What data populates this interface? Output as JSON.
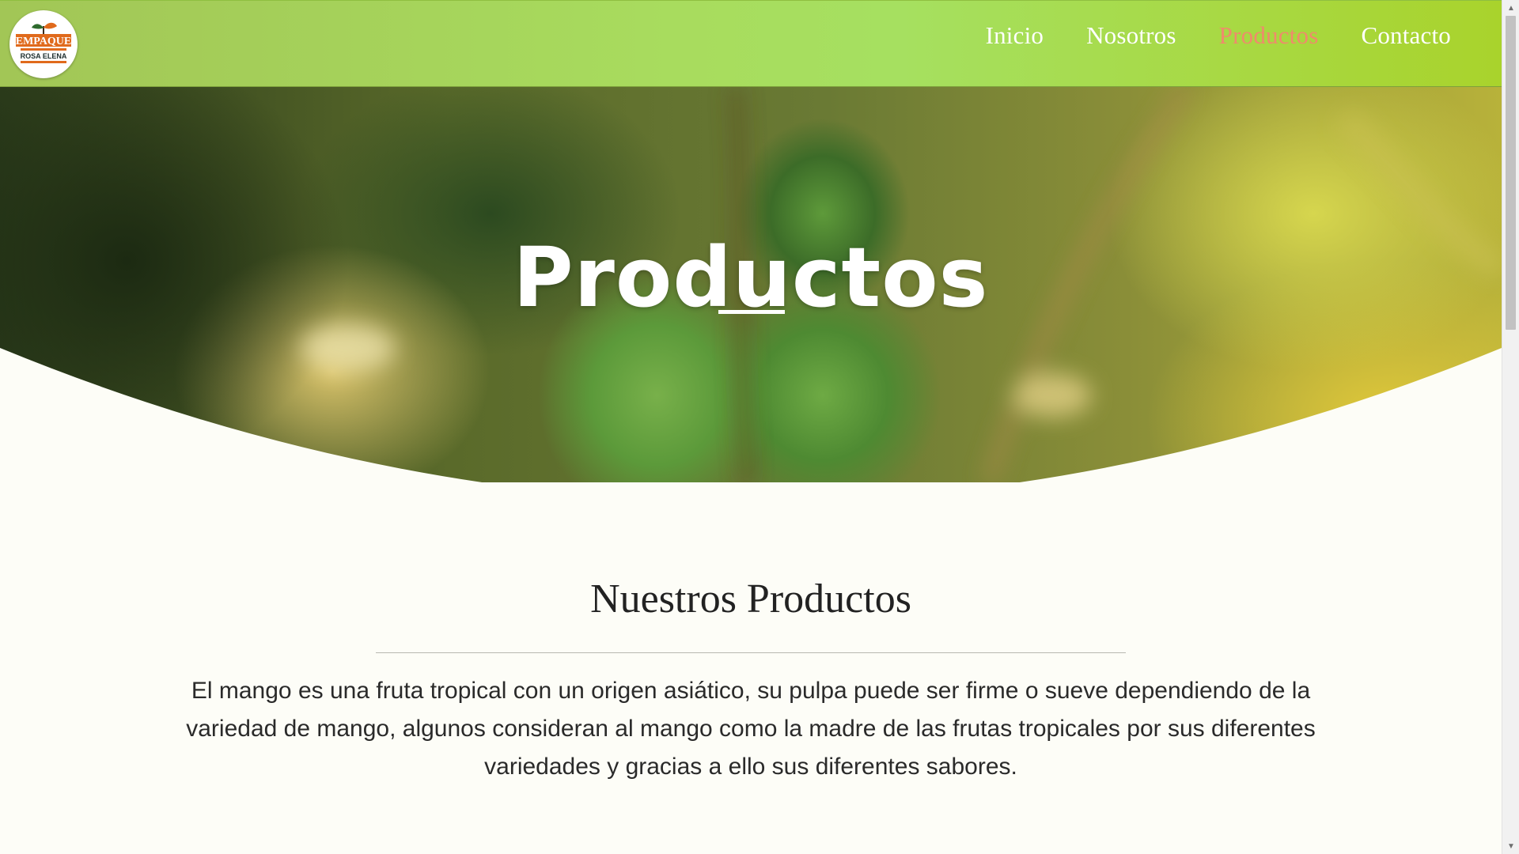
{
  "nav": {
    "logo": {
      "line1": "EMPAQUE",
      "line2": "ROSA ELENA"
    },
    "links": [
      {
        "label": "Inicio",
        "active": false
      },
      {
        "label": "Nosotros",
        "active": false
      },
      {
        "label": "Productos",
        "active": true
      },
      {
        "label": "Contacto",
        "active": false
      }
    ]
  },
  "hero": {
    "title": "Productos"
  },
  "section": {
    "title": "Nuestros Productos",
    "text": "El mango es una fruta tropical con un origen asiático, su pulpa puede ser firme o sueve dependiendo de la variedad de mango, algunos consideran al mango como la madre de las frutas tropicales por sus diferentes variedades y gracias a ello sus diferentes sabores."
  },
  "colors": {
    "nav_active": "#f08a6c",
    "nav_text": "#ffffff",
    "logo_orange": "#e06a1c"
  },
  "icons": {
    "scroll_up": "scroll-up-arrow-icon",
    "scroll_down": "scroll-down-arrow-icon"
  }
}
